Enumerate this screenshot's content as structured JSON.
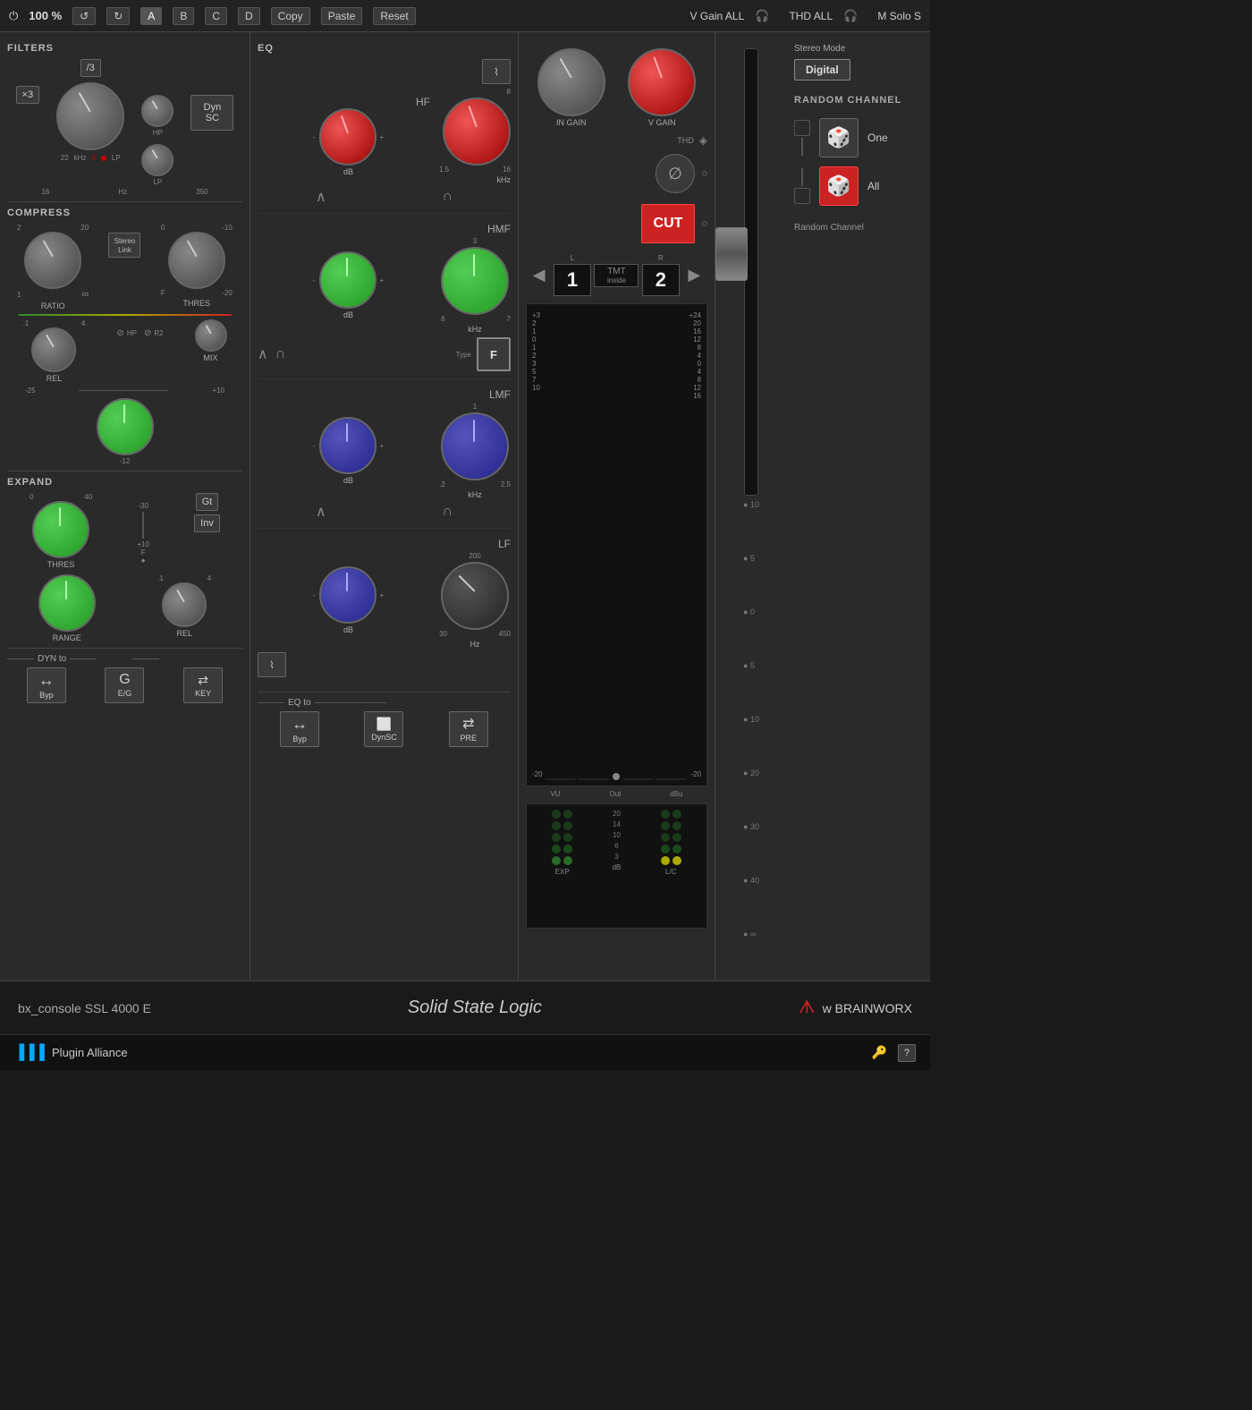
{
  "toolbar": {
    "power": "⏻",
    "zoom": "100 %",
    "undo": "↺",
    "redo": "↻",
    "a": "A",
    "b": "B",
    "c": "C",
    "d": "D",
    "copy": "Copy",
    "paste": "Paste",
    "reset": "Reset",
    "v_gain_all": "V Gain ALL",
    "thd_all": "THD ALL",
    "m_solo_s": "M Solo S",
    "headphone": "🎧"
  },
  "filters": {
    "label": "FILTERS",
    "x3_label": "×3",
    "div3_label": "/3",
    "hp_label": "HP",
    "lp_label": "LP",
    "hz_label": "Hz",
    "khz_label": "kHz",
    "sc_label": "SC",
    "dyn_label": "Dyn",
    "val_16": "16",
    "val_350": "350",
    "val_22": "22",
    "val_3": "3"
  },
  "compress": {
    "label": "COMPRESS",
    "ratio_label": "RATIO",
    "thres_label": "THRES",
    "rel_label": "REL",
    "mix_label": "MIX",
    "stereo_link": "Stereo Link",
    "val_2": "2",
    "val_20": "20",
    "val_1": "1",
    "val_inf": "∞",
    "val_0": "0",
    "val_neg10": "-10",
    "val_f": "F",
    "val_pos10": "+10",
    "val_neg20": "-20",
    "val_01": ".1",
    "val_4": "4",
    "hp_label": "HP",
    "r2_label": "R2",
    "neg12": "-12",
    "neg25": "-25"
  },
  "expand": {
    "label": "EXPAND",
    "thres_label": "THRES",
    "range_label": "RANGE",
    "rel_label": "REL",
    "gt_label": "Gt",
    "inv_label": "Inv",
    "val_0": "0",
    "val_40": "40",
    "val_neg30": "-30",
    "val_pos10": "+10",
    "val_f": "F",
    "val_01": ".1",
    "val_4": "4"
  },
  "dyn_routing": {
    "label": "DYN to",
    "byp_label": "Byp",
    "eg_label": "E/G",
    "key_label": "KEY"
  },
  "eq": {
    "label": "EQ",
    "hf_label": "HF",
    "hf_db": "dB",
    "hf_khz": "kHz",
    "val_8": "8",
    "val_pos": "+",
    "val_neg": "-",
    "val_1_5": "1.5",
    "val_16": "16",
    "hmf_label": "HMF",
    "hmf_db": "dB",
    "hmf_khz": "kHz",
    "val_3": "3",
    "val_6": ".6",
    "val_7": "7",
    "type_label": "Type",
    "type_f": "F",
    "lmf_label": "LMF",
    "lmf_db": "dB",
    "lmf_khz": "kHz",
    "val_1": "1",
    "val_02": ".2",
    "val_2_5": "2.5",
    "lf_label": "LF",
    "lf_hz": "Hz",
    "lf_db": "dB",
    "val_200": "200",
    "val_30": "30",
    "val_450": "450"
  },
  "eq_routing": {
    "label": "EQ to",
    "byp_label": "Byp",
    "dynsc_label": "DynSC",
    "pre_label": "PRE"
  },
  "channel": {
    "in_gain_label": "IN GAIN",
    "v_gain_label": "V GAIN",
    "thd_label": "THD",
    "cut_label": "CUT",
    "stereo_mode": "Stereo Mode",
    "digital_label": "Digital",
    "left_ch": "1",
    "right_ch": "2",
    "tmt_label": "TMT",
    "tmt_inside": "inside",
    "phase_symbol": "∅",
    "l_label": "L",
    "r_label": "R"
  },
  "random_channel": {
    "label": "RANDOM CHANNEL",
    "random_channel_label": "Random Channel",
    "one_label": "One",
    "all_label": "All"
  },
  "meters": {
    "scale_top": "+3",
    "scale_values": [
      "+3",
      "2",
      "1",
      "0",
      "1",
      "2",
      "3",
      "5",
      "7",
      "10",
      "-20"
    ],
    "right_scale": [
      "+24",
      "20",
      "16",
      "12",
      "8",
      "4",
      "0",
      "4",
      "8",
      "12",
      "16",
      "-20"
    ],
    "vu_label": "VU",
    "out_label": "Out",
    "dbu_label": "dBu"
  },
  "fader_scale": {
    "values": [
      "10",
      "5",
      "0",
      "5",
      "10",
      "20",
      "30",
      "40",
      "∞"
    ]
  },
  "bottom_meters": {
    "exp_label": "EXP",
    "db_label": "dB",
    "lc_label": "L/C",
    "scale_values": [
      "20",
      "14",
      "10",
      "6",
      "3"
    ]
  },
  "footer": {
    "plugin_name": "bx_console SSL 4000 E",
    "brand": "Solid State Logic",
    "brainworx": "w BRAINWORX"
  },
  "pa_bar": {
    "logo": "▐▐▐ Plugin Alliance",
    "key_icon": "🔑",
    "help": "?"
  }
}
